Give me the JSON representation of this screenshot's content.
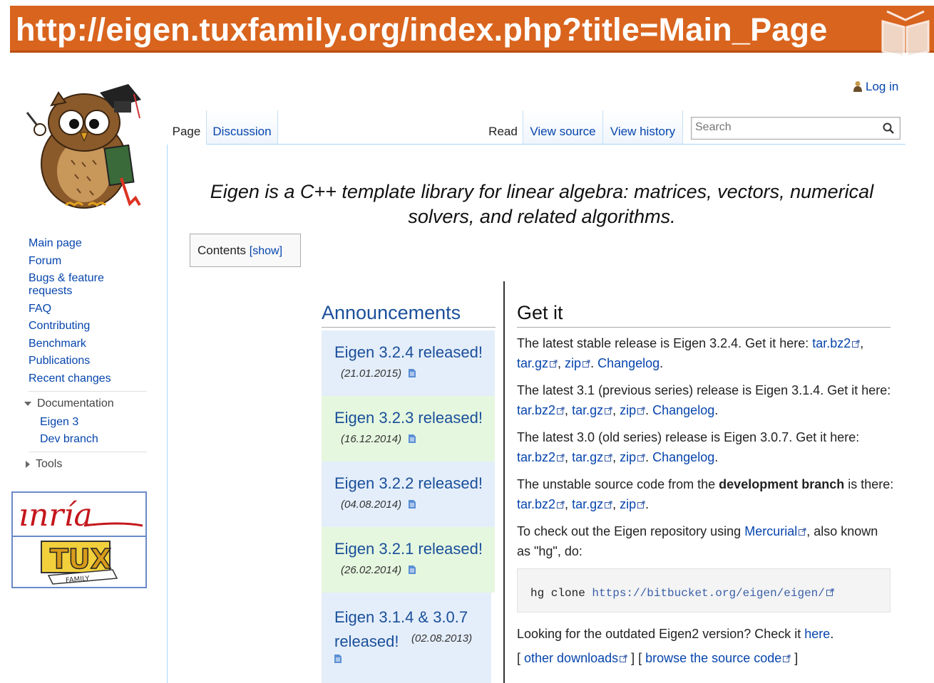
{
  "banner": {
    "url": "http://eigen.tuxfamily.org/index.php?title=Main_Page"
  },
  "user": {
    "login": "Log in"
  },
  "tabs": {
    "page": "Page",
    "discussion": "Discussion",
    "read": "Read",
    "view_source": "View source",
    "view_history": "View history"
  },
  "search": {
    "placeholder": "Search"
  },
  "sidebar": {
    "nav": [
      "Main page",
      "Forum",
      "Bugs & feature requests",
      "FAQ",
      "Contributing",
      "Benchmark",
      "Publications",
      "Recent changes"
    ],
    "documentation": {
      "label": "Documentation",
      "items": [
        "Eigen 3",
        "Dev branch"
      ]
    },
    "tools": "Tools",
    "partners": {
      "inria": "ınría",
      "tux": "TUX",
      "tux_sub": "FAMILY"
    }
  },
  "tagline": "Eigen is a C++ template library for linear algebra: matrices, vectors, numerical solvers, and related algorithms.",
  "toc": {
    "label": "Contents",
    "toggle": "[show]"
  },
  "announcements": {
    "title": "Announcements",
    "items": [
      {
        "headline": "Eigen 3.2.4 released!",
        "date": "(21.01.2015)"
      },
      {
        "headline": "Eigen 3.2.3 released!",
        "date": "(16.12.2014)"
      },
      {
        "headline": "Eigen 3.2.2 released!",
        "date": "(04.08.2014)"
      },
      {
        "headline": "Eigen 3.2.1 released!",
        "date": "(26.02.2014)"
      },
      {
        "headline": "Eigen 3.1.4 & 3.0.7 released!",
        "date": "(02.08.2013)"
      }
    ]
  },
  "getit": {
    "title": "Get it",
    "p1": {
      "text": "The latest stable release is Eigen 3.2.4. Get it here:",
      "links": [
        "tar.bz2",
        "tar.gz",
        "zip",
        "Changelog"
      ]
    },
    "p2": {
      "text": "The latest 3.1 (previous series) release is Eigen 3.1.4. Get it here:",
      "links": [
        "tar.bz2",
        "tar.gz",
        "zip",
        "Changelog"
      ]
    },
    "p3": {
      "text": "The latest 3.0 (old series) release is Eigen 3.0.7. Get it here:",
      "links": [
        "tar.bz2",
        "tar.gz",
        "zip",
        "Changelog"
      ]
    },
    "p4": {
      "text_a": "The unstable source code from the",
      "bold": "development branch",
      "text_b": "is there:",
      "links": [
        "tar.bz2",
        "tar.gz",
        "zip"
      ]
    },
    "p5": {
      "text_a": "To check out the Eigen repository using",
      "link": "Mercurial",
      "text_b": ", also known as \"hg\", do:"
    },
    "code": {
      "command": "hg clone",
      "url": "https://bitbucket.org/eigen/eigen/"
    },
    "p6": {
      "text": "Looking for the outdated Eigen2 version? Check it",
      "link": "here"
    },
    "bottom": {
      "other": "other downloads",
      "browse": "browse the source code"
    }
  }
}
